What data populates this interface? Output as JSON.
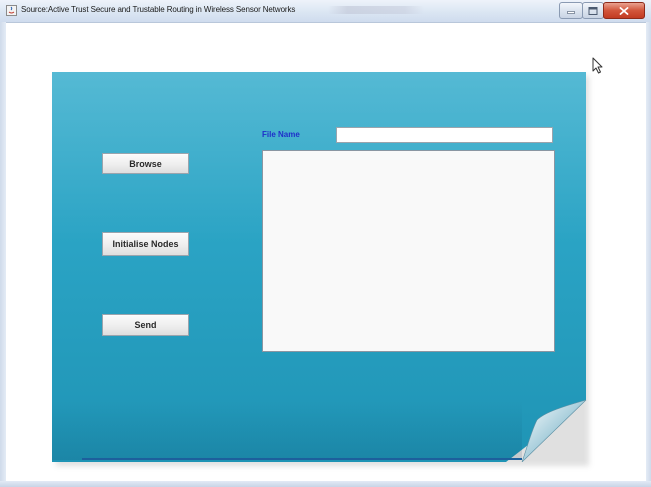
{
  "window": {
    "title": "Source:Active Trust Secure and Trustable Routing in Wireless Sensor Networks",
    "icons": {
      "app": "java-app-icon",
      "minimize": "minimize-icon",
      "maximize": "maximize-icon",
      "close": "close-icon"
    }
  },
  "form": {
    "file_name_label": "File Name",
    "file_name_value": "",
    "text_area_value": ""
  },
  "buttons": {
    "browse": "Browse",
    "initialise_nodes": "Initialise Nodes",
    "send": "Send"
  },
  "colors": {
    "panel": "#2aa3c4",
    "label": "#1f2fc9",
    "close_button": "#c7432a"
  },
  "cursor": "mouse-pointer-icon"
}
